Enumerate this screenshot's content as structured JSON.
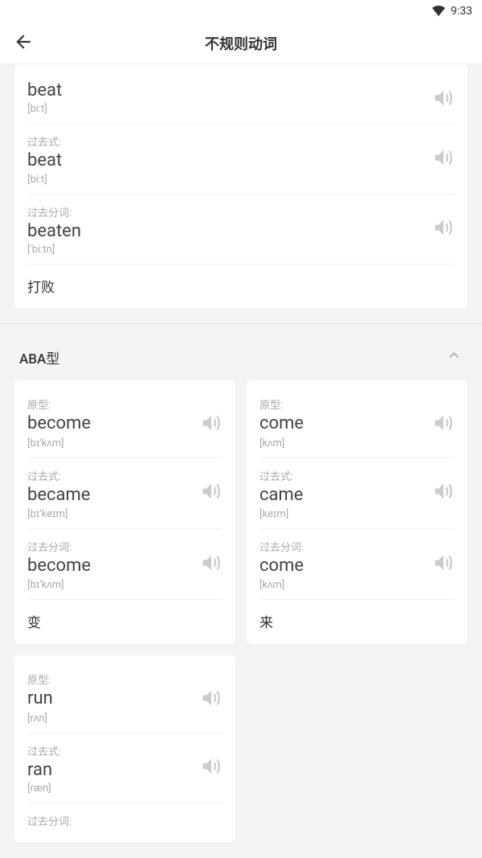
{
  "status": {
    "time": "9:33"
  },
  "nav": {
    "title": "不规则动词"
  },
  "labels": {
    "base": "原型:",
    "past": "过去式:",
    "pp": "过去分词:"
  },
  "topCard": {
    "base": {
      "word": "beat",
      "pron": "[bi:t]"
    },
    "past": {
      "word": "beat",
      "pron": "[bi:t]"
    },
    "pp": {
      "word": "beaten",
      "pron": "['bi:tn]"
    },
    "meaning": "打败"
  },
  "section": {
    "title": "ABA型"
  },
  "cards": [
    {
      "base": {
        "word": "become",
        "pron": "[bɪ'kʌm]"
      },
      "past": {
        "word": "became",
        "pron": "[bɪ'keɪm]"
      },
      "pp": {
        "word": "become",
        "pron": "[bɪ'kʌm]"
      },
      "meaning": "变"
    },
    {
      "base": {
        "word": "come",
        "pron": "[kʌm]"
      },
      "past": {
        "word": "came",
        "pron": "[keɪm]"
      },
      "pp": {
        "word": "come",
        "pron": "[kʌm]"
      },
      "meaning": "来"
    },
    {
      "base": {
        "word": "run",
        "pron": "[rʌn]"
      },
      "past": {
        "word": "ran",
        "pron": "[ræn]"
      },
      "ppLabelOnly": true
    }
  ]
}
